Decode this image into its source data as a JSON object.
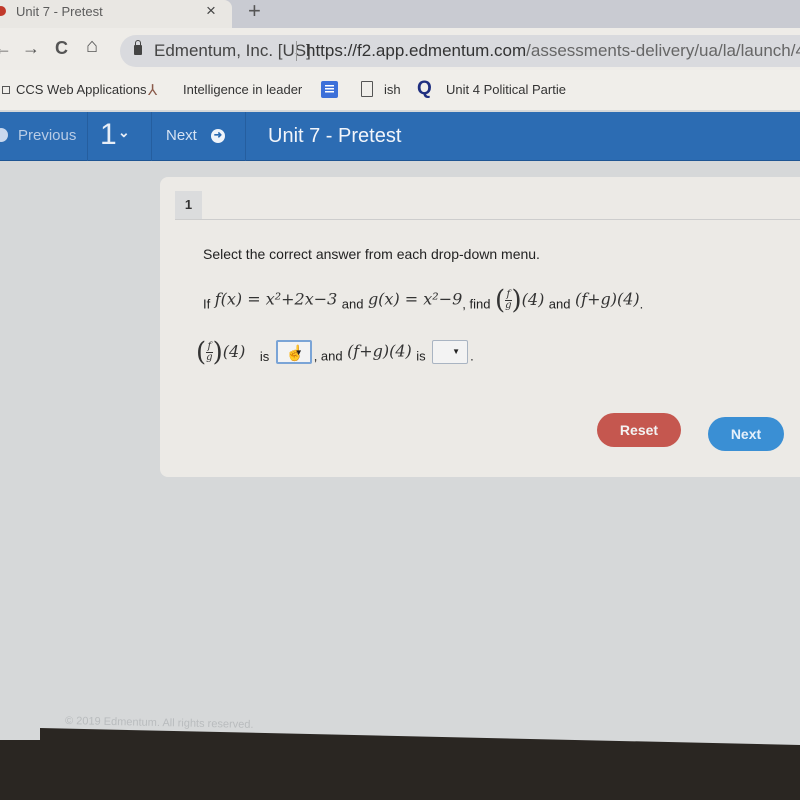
{
  "browser": {
    "tab_title": "Unit 7 - Pretest",
    "tab_close": "×",
    "new_tab": "+",
    "nav": {
      "back": "←",
      "forward": "→",
      "reload": "C",
      "home": "⌂"
    },
    "site_identity": "Edmentum, Inc. [US]",
    "url_host": "https://f2.app.edmentum.com",
    "url_path": "/assessments-delivery/ua/la/launch/4",
    "bookmarks": [
      {
        "label": "CCS Web Applications",
        "icon": "apps-icon"
      },
      {
        "label": "Intelligence in leader",
        "icon": "figure-icon"
      },
      {
        "label": "",
        "icon": "google-docs-icon"
      },
      {
        "label": "ish",
        "icon": "file-icon"
      },
      {
        "label": "Unit 4 Political Partie",
        "icon": "quizlet-icon"
      }
    ]
  },
  "appbar": {
    "previous_label": "Previous",
    "question_number": "1",
    "question_chevron": "⌄",
    "next_label": "Next",
    "next_icon": "➜",
    "title": "Unit 7 - Pretest",
    "color": "#2c6cb3"
  },
  "question": {
    "number": "1",
    "instructions": "Select the correct answer from each drop-down menu.",
    "problem": {
      "if": "If",
      "f_def": "f(x) = x²+2x−3",
      "and1": "and",
      "g_def": "g(x) = x²−9",
      "find": ", find",
      "expr1_tail": "(4)",
      "and2": "and",
      "expr2": "(f+g)(4)",
      "period": "."
    },
    "answer": {
      "expr1_tail": "(4)",
      "is1": "is",
      "and": ", and",
      "expr2": "(f+g)(4)",
      "is2": "is",
      "period": ".",
      "dropdown1_value": "",
      "dropdown2_value": "",
      "caret": "▼"
    },
    "fraction": {
      "num": "f",
      "den": "g"
    }
  },
  "buttons": {
    "reset": "Reset",
    "next": "Next",
    "reset_color": "#c5574f",
    "next_color": "#3a8fd4"
  },
  "footer": "© 2019 Edmentum. All rights reserved."
}
